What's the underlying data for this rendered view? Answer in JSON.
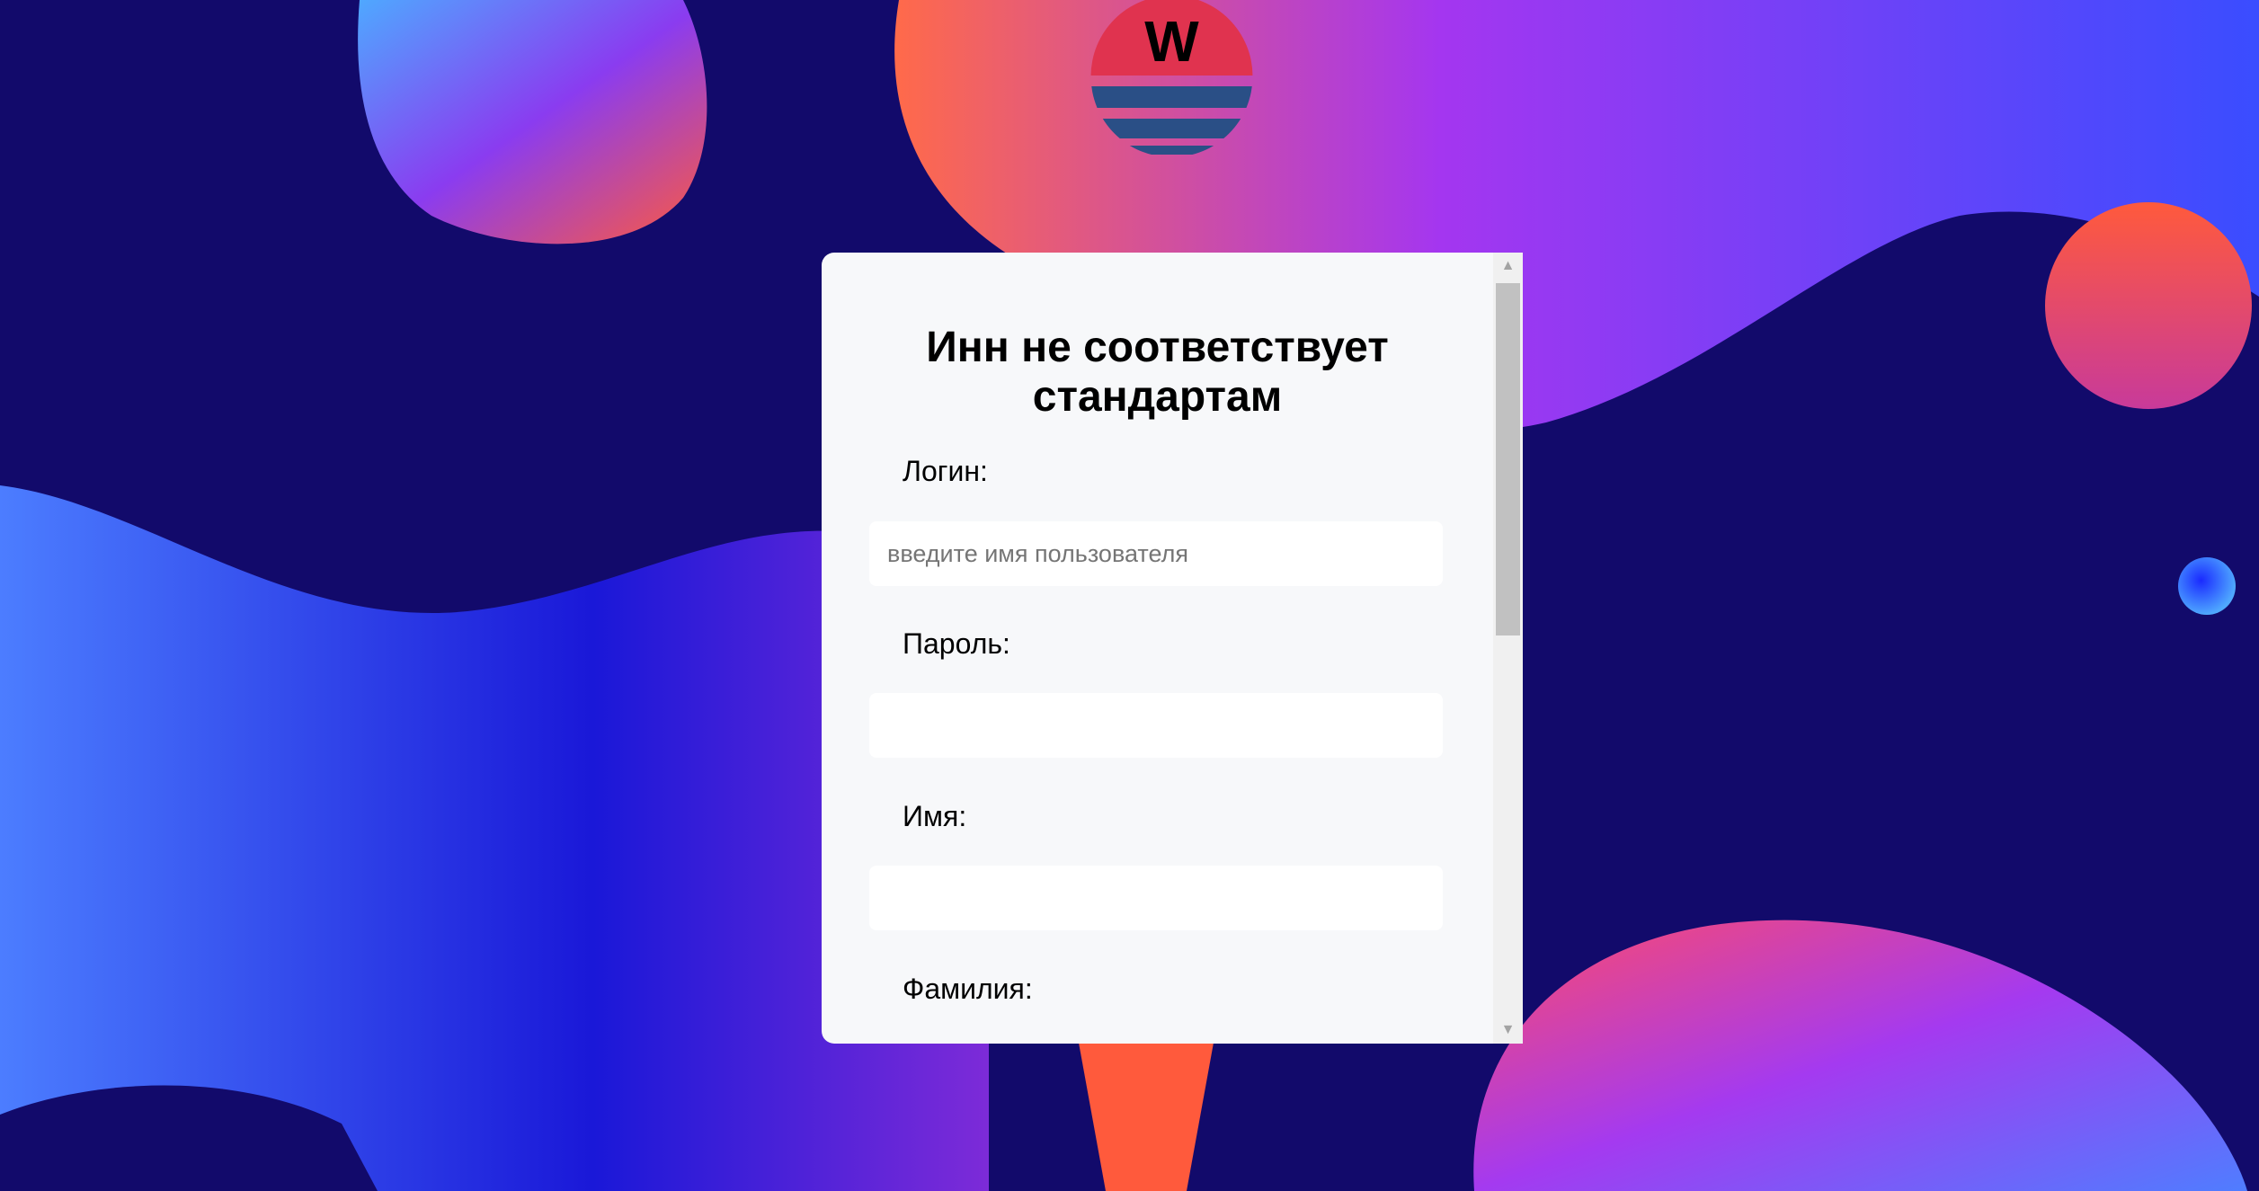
{
  "form": {
    "title": "Инн не соответствует стандартам",
    "login_label": "Логин:",
    "login_placeholder": "введите имя пользователя",
    "login_value": "",
    "password_label": "Пароль:",
    "password_value": "",
    "first_name_label": "Имя:",
    "first_name_value": "",
    "last_name_label": "Фамилия:"
  },
  "logo": {
    "letter": "W",
    "colors": {
      "top": "#e0334f",
      "stripes": "#2a4f86"
    }
  },
  "colors": {
    "background": "#120a6b",
    "card": "#f7f8fa",
    "input": "#ffffff"
  }
}
